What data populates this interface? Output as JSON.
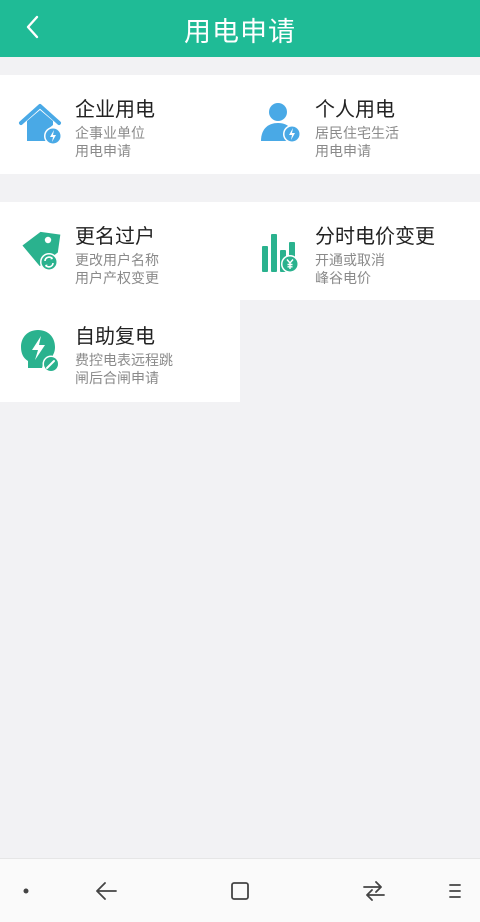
{
  "header": {
    "title": "用电申请"
  },
  "tiles": [
    {
      "title": "企业用电",
      "line1": "企事业单位",
      "line2": "用电申请",
      "icon": "enterprise-house-icon"
    },
    {
      "title": "个人用电",
      "line1": "居民住宅生活",
      "line2": "用电申请",
      "icon": "person-icon"
    },
    {
      "title": "更名过户",
      "line1": "更改用户名称",
      "line2": "用户产权变更",
      "icon": "tag-icon"
    },
    {
      "title": "分时电价变更",
      "line1": "开通或取消",
      "line2": "峰谷电价",
      "icon": "bar-chart-yuan-icon"
    },
    {
      "title": "自助复电",
      "line1": "费控电表远程跳",
      "line2": "闸后合闸申请",
      "icon": "power-restore-icon"
    }
  ],
  "colors": {
    "accent": "#1fbb96",
    "icon_blue": "#49a9e6",
    "icon_teal": "#2ab28e"
  }
}
